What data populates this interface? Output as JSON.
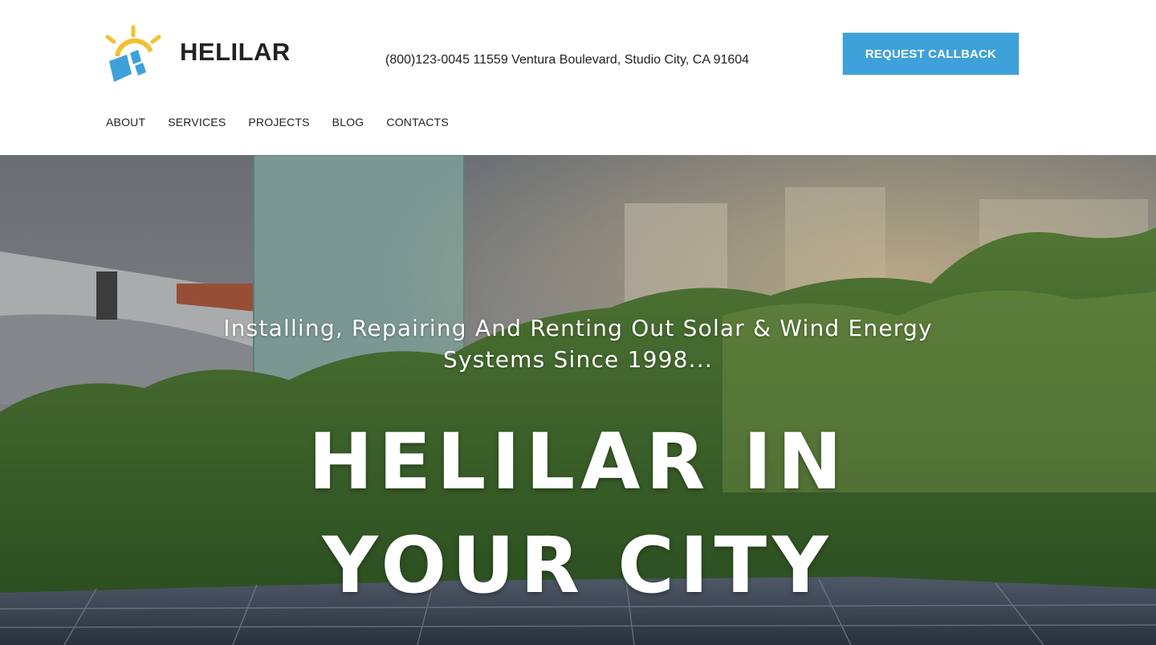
{
  "brand": {
    "name": "HELILAR",
    "logo_icon": "sun-solar-panel-icon",
    "accent_color": "#3ea1da",
    "sun_color": "#f2c12e"
  },
  "header": {
    "contact": "(800)123-0045 11559 Ventura Boulevard, Studio City, CA 91604",
    "cta_label": "REQUEST CALLBACK"
  },
  "nav": {
    "items": [
      {
        "label": "ABOUT"
      },
      {
        "label": "SERVICES"
      },
      {
        "label": "PROJECTS"
      },
      {
        "label": "BLOG"
      },
      {
        "label": "CONTACTS"
      }
    ]
  },
  "hero": {
    "background": "city-skyline-trees-solar-panels-photo",
    "subtitle": "Installing, Repairing And Renting Out Solar & Wind Energy Systems Since 1998...",
    "title": "HELILAR IN YOUR CITY"
  }
}
